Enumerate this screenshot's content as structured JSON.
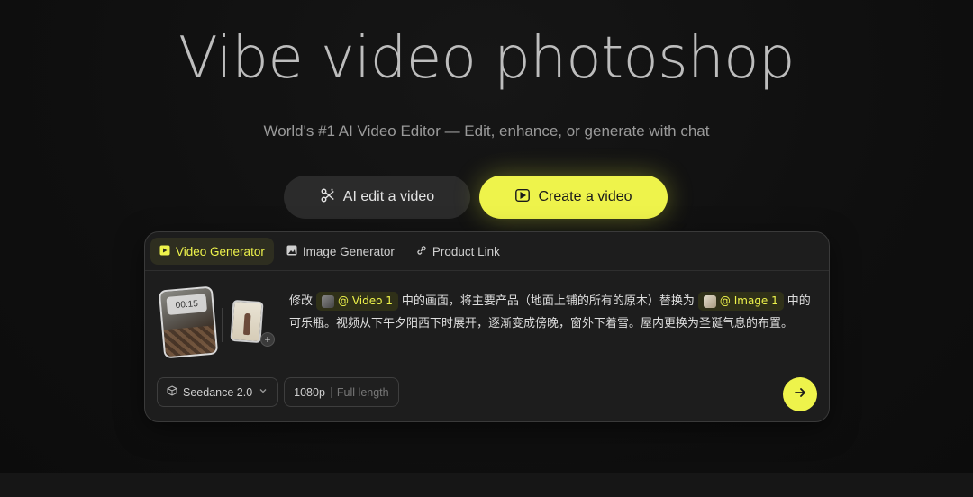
{
  "hero": {
    "title": "Vibe video photoshop",
    "subtitle": "World's #1 AI Video Editor — Edit, enhance, or generate with chat"
  },
  "modes": {
    "edit_label": "AI edit a video",
    "create_label": "Create a video"
  },
  "tabs": [
    {
      "label": "Video Generator",
      "active": true
    },
    {
      "label": "Image Generator",
      "active": false
    },
    {
      "label": "Product Link",
      "active": false
    }
  ],
  "assets": {
    "video_duration": "00:15"
  },
  "prompt": {
    "part1": "修改",
    "chip1": "@ Video 1",
    "part2": "中的画面，将主要产品（地面上铺的所有的原木）替换为",
    "chip2": "@ Image 1",
    "part3": "中的可乐瓶。视频从下午夕阳西下时展开，逐渐变成傍晚，窗外下着雪。屋内更换为圣诞气息的布置。"
  },
  "controls": {
    "model": "Seedance 2.0",
    "resolution": "1080p",
    "length": "Full length"
  },
  "colors": {
    "accent": "#eef34b",
    "background": "#101010",
    "panel": "#1d1d1d"
  }
}
